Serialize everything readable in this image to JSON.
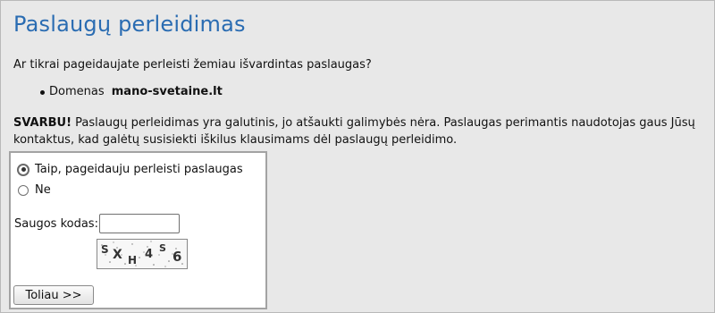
{
  "page": {
    "title": "Paslaugų perleidimas",
    "question": "Ar tikrai pageidaujate perleisti žemiau išvardintas paslaugas?",
    "services": [
      {
        "type_label": "Domenas",
        "name": "mano-svetaine.lt"
      }
    ],
    "warning": {
      "label": "SVARBU!",
      "text": " Paslaugų perleidimas yra galutinis, jo atšaukti galimybės nėra. Paslaugas perimantis naudotojas gaus Jūsų kontaktus, kad galėtų susisiekti iškilus klausimams dėl paslaugų perleidimo."
    }
  },
  "form": {
    "options": [
      {
        "label": "Taip, pageidauju perleisti paslaugas",
        "selected": true
      },
      {
        "label": "Ne",
        "selected": false
      }
    ],
    "captcha_label": "Saugos kodas:",
    "captcha_value": "",
    "captcha_image_text": "SXH4S6",
    "submit_label": "Toliau >>"
  }
}
